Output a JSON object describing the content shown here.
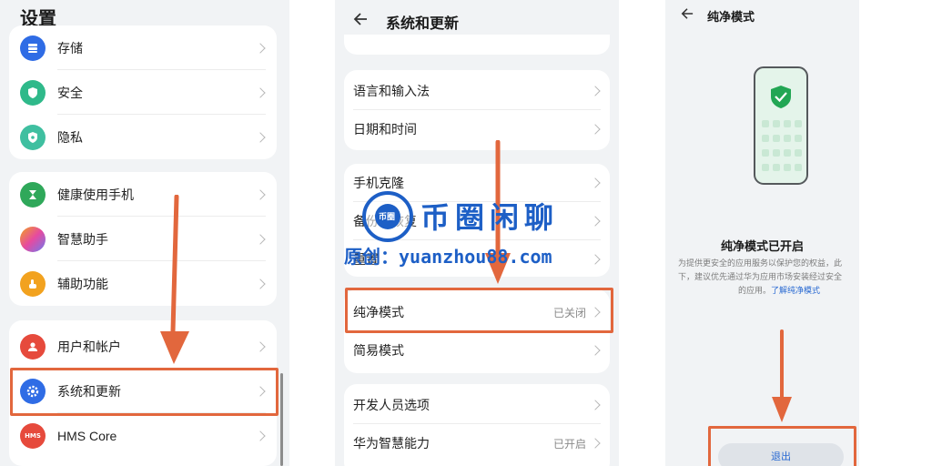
{
  "colors": {
    "highlight": "#e2673d",
    "arrow": "#e2673d",
    "link": "#2a6ad2",
    "watermark": "#1d5fc6"
  },
  "panel1": {
    "title": "设置",
    "items": [
      {
        "label": "存储",
        "icon": "storage-icon",
        "color": "#2f6ce5"
      },
      {
        "label": "安全",
        "icon": "shield-icon",
        "color": "#2fb98a"
      },
      {
        "label": "隐私",
        "icon": "privacy-shield-icon",
        "color": "#3fbfa0"
      },
      {
        "label": "健康使用手机",
        "icon": "hourglass-icon",
        "color": "#2fa85a"
      },
      {
        "label": "智慧助手",
        "icon": "assistant-orb-icon",
        "color": "#9b6cf0"
      },
      {
        "label": "辅助功能",
        "icon": "hand-icon",
        "color": "#f2a21f"
      },
      {
        "label": "用户和帐户",
        "icon": "user-icon",
        "color": "#e64a3c"
      },
      {
        "label": "系统和更新",
        "icon": "gear-icon",
        "color": "#2f6ce5"
      },
      {
        "label": "HMS Core",
        "icon": "hms-icon",
        "icon_text": "HMS",
        "color": "#e64a3c"
      }
    ]
  },
  "panel2": {
    "title": "系统和更新",
    "items": [
      {
        "label": "语言和输入法",
        "status": ""
      },
      {
        "label": "日期和时间",
        "status": ""
      },
      {
        "label": "手机克隆",
        "status": ""
      },
      {
        "label": "备份和恢复",
        "status": ""
      },
      {
        "label": "重置",
        "status": ""
      },
      {
        "label": "纯净模式",
        "status": "已关闭"
      },
      {
        "label": "简易模式",
        "status": ""
      },
      {
        "label": "开发人员选项",
        "status": ""
      },
      {
        "label": "华为智慧能力",
        "status": "已开启"
      }
    ]
  },
  "panel3": {
    "title": "纯净模式",
    "heading": "纯净模式已开启",
    "desc_line1": "为提供更安全的应用服务以保护您的权益，此",
    "desc_line2": "下，建议优先通过华为应用市场安装经过安全",
    "desc_line3": "的应用。",
    "link": "了解纯净模式",
    "exit_button": "退出"
  },
  "watermark": {
    "seal_text": "币圈",
    "title": "币圈闲聊",
    "subtitle": "原创：yuanzhou88.com"
  }
}
